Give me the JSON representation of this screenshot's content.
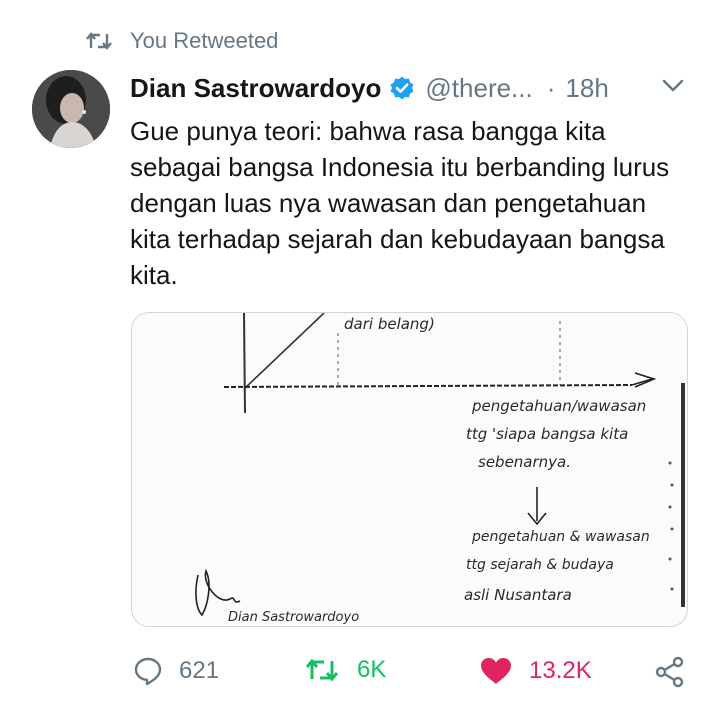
{
  "retweet_context": {
    "label": "You Retweeted",
    "icon": "retweet-icon"
  },
  "tweet": {
    "author_name": "Dian Sastrowardoyo",
    "handle": "@there...",
    "separator": "·",
    "time": "18h",
    "text": "Gue punya teori: bahwa rasa bangga kita sebagai bangsa Indonesia itu berbanding lurus dengan luas nya wawasan dan pengetahuan kita terhadap sejarah dan kebudayaan bangsa kita."
  },
  "media": {
    "handwriting": {
      "top_label": "dari belang)",
      "line1": "pengetahuan/wawasan",
      "line2": "ttg 'siapa bangsa kita",
      "line3": "sebenarnya.",
      "line4": "pengetahuan & wawasan",
      "line5": "ttg sejarah & budaya",
      "line6": "asli Nusantara",
      "signature": "Dian Sastrowardoyo"
    }
  },
  "actions": {
    "reply_count": "621",
    "retweet_count": "6K",
    "like_count": "13.2K"
  },
  "colors": {
    "retweet_green": "#17bf63",
    "like_red": "#e0245e",
    "verified_blue": "#1da1f2",
    "muted_gray": "#657786"
  }
}
